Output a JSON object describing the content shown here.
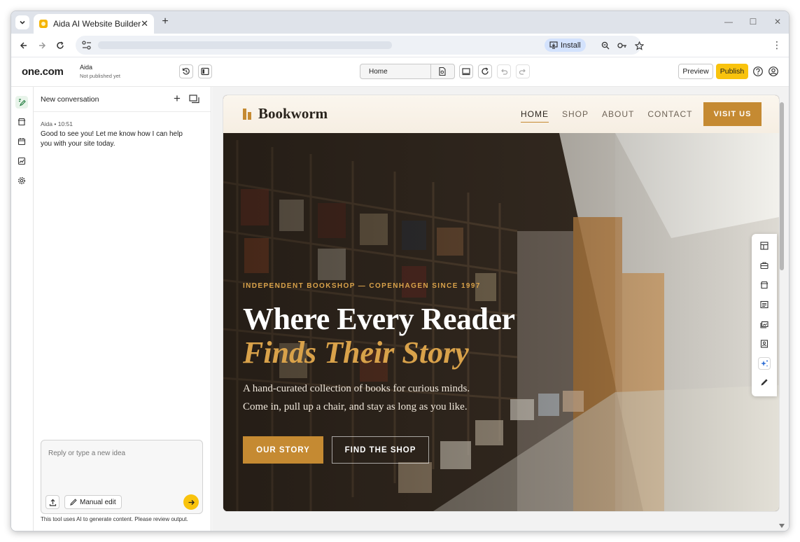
{
  "browser": {
    "tab_title": "Aida AI Website Builder",
    "install_label": "Install"
  },
  "app": {
    "logo": "one.com",
    "project_name": "Aida",
    "project_status": "Not published yet",
    "page_selector": "Home",
    "preview_label": "Preview",
    "publish_label": "Publish"
  },
  "chat": {
    "title": "New conversation",
    "message": {
      "meta": "Aida • 10:51",
      "text": "Good to see you! Let me know how I can help you with your site today."
    },
    "input_placeholder": "Reply or type a new idea",
    "manual_edit_label": "Manual edit",
    "disclaimer": "This tool uses AI to generate content. Please review output."
  },
  "site": {
    "brand": "Bookworm",
    "nav": [
      "HOME",
      "SHOP",
      "ABOUT",
      "CONTACT"
    ],
    "visit_button": "VISIT US",
    "eyebrow": "INDEPENDENT BOOKSHOP — COPENHAGEN SINCE 1997",
    "headline_1": "Where Every Reader",
    "headline_2": "Finds Their Story",
    "sub_1": "A hand-curated collection of books for curious minds.",
    "sub_2": "Come in, pull up a chair, and stay as long as you like.",
    "cta_primary": "OUR STORY",
    "cta_secondary": "FIND THE SHOP"
  },
  "colors": {
    "accent_yellow": "#f9c30d",
    "brand_gold": "#c58a32",
    "headline_gold": "#d9a24a"
  }
}
